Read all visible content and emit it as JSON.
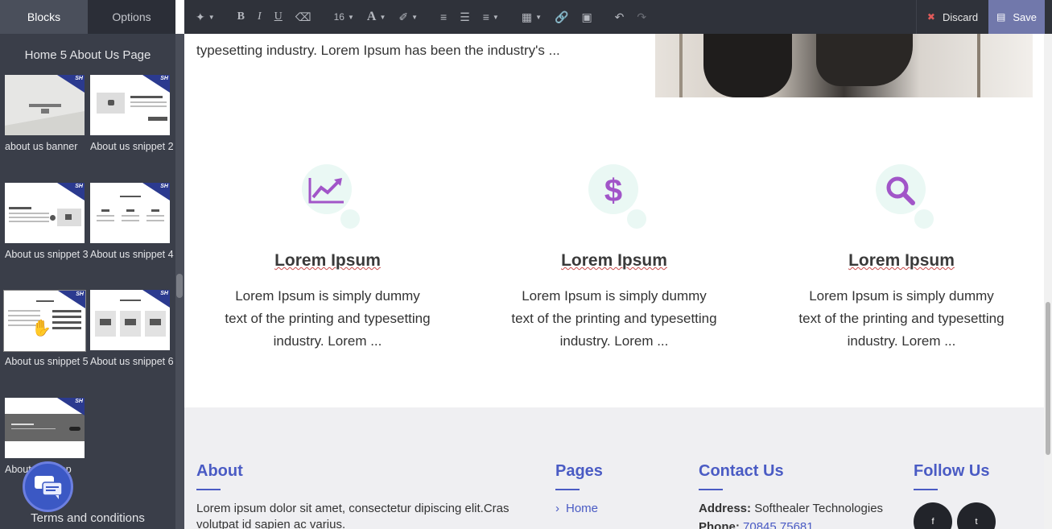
{
  "sidebar": {
    "tabs": [
      {
        "label": "Blocks",
        "active": true
      },
      {
        "label": "Options",
        "active": false
      }
    ],
    "category_title": "Home 5 About Us Page",
    "snippets": [
      {
        "label": "about us banner",
        "badge": "SH"
      },
      {
        "label": "About us snippet 2",
        "badge": "SH"
      },
      {
        "label": "About us snippet 3",
        "badge": "SH"
      },
      {
        "label": "About us snippet 4",
        "badge": "SH"
      },
      {
        "label": "About us snippet 5",
        "badge": "SH"
      },
      {
        "label": "About us snippet 6",
        "badge": "SH"
      },
      {
        "label": "About us snipp",
        "badge": "SH"
      }
    ],
    "next_category": "Terms and conditions"
  },
  "toolbar": {
    "font_size": "16",
    "discard_label": "Discard",
    "save_label": "Save",
    "tools": [
      "magic-wand",
      "bold",
      "italic",
      "underline",
      "eraser",
      "font-size",
      "font-color",
      "paint-brush",
      "bullet-list",
      "numbered-list",
      "align",
      "table",
      "link",
      "image",
      "undo",
      "redo"
    ]
  },
  "page": {
    "intro_text": "typesetting industry. Lorem Ipsum has been the industry's ...",
    "features": [
      {
        "icon": "chart-trend-icon",
        "title": "Lorem Ipsum",
        "text": "Lorem Ipsum is simply dummy text of the printing and typesetting industry. Lorem ..."
      },
      {
        "icon": "dollar-icon",
        "title": "Lorem Ipsum",
        "text": "Lorem Ipsum is simply dummy text of the printing and typesetting industry. Lorem ..."
      },
      {
        "icon": "search-icon",
        "title": "Lorem Ipsum",
        "text": "Lorem Ipsum is simply dummy text of the printing and typesetting industry. Lorem ..."
      }
    ],
    "footer": {
      "about": {
        "heading": "About",
        "text": "Lorem ipsum dolor sit amet, consectetur dipiscing elit.Cras volutpat id sapien ac varius."
      },
      "pages": {
        "heading": "Pages",
        "links": [
          "Home"
        ]
      },
      "contact": {
        "heading": "Contact Us",
        "address_label": "Address:",
        "address": "Softhealer Technologies",
        "phone_label": "Phone:",
        "phone": "70845 75681"
      },
      "follow": {
        "heading": "Follow Us",
        "socials": [
          "f",
          "t"
        ]
      }
    }
  },
  "colors": {
    "accent": "#4a5bc4",
    "icon": "#a155c8",
    "sidebar": "#3a3e49",
    "save": "#7178ab"
  }
}
